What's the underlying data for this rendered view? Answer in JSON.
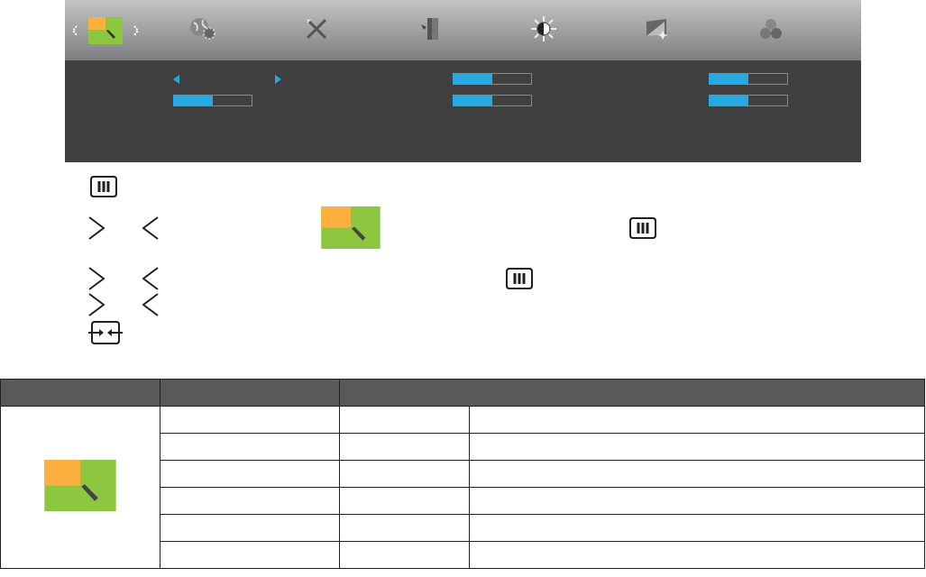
{
  "osd": {
    "tabs": [
      {
        "kind": "color-boost",
        "selected": true
      },
      {
        "kind": "globe-gear",
        "selected": false
      },
      {
        "kind": "tools",
        "selected": false
      },
      {
        "kind": "exit",
        "selected": false
      },
      {
        "kind": "brightness",
        "selected": false
      },
      {
        "kind": "picture",
        "selected": false
      },
      {
        "kind": "circles",
        "selected": false
      }
    ],
    "columns": [
      {
        "controls": [
          {
            "kind": "selector"
          },
          {
            "kind": "slider",
            "level": 0.5
          }
        ]
      },
      {
        "controls": [
          {
            "kind": "slider",
            "level": 0.5
          },
          {
            "kind": "slider",
            "level": 0.5
          }
        ]
      },
      {
        "controls": [
          {
            "kind": "slider",
            "level": 0.5
          },
          {
            "kind": "slider",
            "level": 0.5
          }
        ]
      }
    ]
  },
  "steps": [
    {
      "icons": [
        {
          "kind": "menu"
        }
      ]
    },
    {
      "icons": [
        {
          "kind": "right"
        },
        {
          "kind": "left"
        },
        {
          "kind": "color-boost"
        },
        {
          "kind": "menu"
        }
      ]
    },
    {
      "icons": [
        {
          "kind": "right"
        },
        {
          "kind": "left"
        },
        {
          "kind": "menu"
        }
      ]
    },
    {
      "icons": [
        {
          "kind": "right"
        },
        {
          "kind": "left"
        }
      ]
    },
    {
      "icons": [
        {
          "kind": "auto"
        }
      ]
    }
  ],
  "table": {
    "icon": {
      "kind": "color-boost"
    }
  }
}
